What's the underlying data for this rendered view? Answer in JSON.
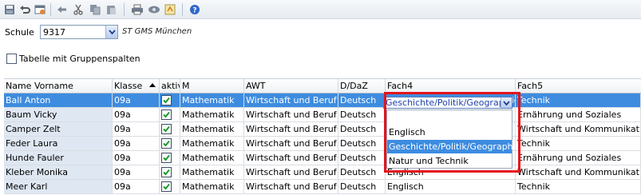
{
  "toolbar": {
    "icons": [
      "save-icon",
      "undo-icon",
      "reset-icon",
      "back-icon",
      "cut-icon",
      "copy-icon",
      "paste-icon",
      "print-icon",
      "preview-icon",
      "export-icon",
      "help-icon"
    ]
  },
  "school": {
    "label": "Schule",
    "value": "9317",
    "name": "ST GMS München"
  },
  "group_columns": {
    "label": "Tabelle mit Gruppenspalten",
    "checked": false
  },
  "grid": {
    "columns": [
      "Name Vorname",
      "Klasse",
      "aktiv",
      "M",
      "AWT",
      "D/DaZ",
      "Fach4",
      "Fach5"
    ],
    "rows": [
      {
        "name": "Ball Anton",
        "klasse": "09a",
        "aktiv": true,
        "m": "Mathematik",
        "awt": "Wirtschaft und Beruf",
        "d": "Deutsch",
        "fach4": "Geschichte/Politik/Geographie",
        "fach5": "Technik",
        "selected": true
      },
      {
        "name": "Baum Vicky",
        "klasse": "09a",
        "aktiv": true,
        "m": "Mathematik",
        "awt": "Wirtschaft und Beruf",
        "d": "Deutsch",
        "fach4": "",
        "fach5": "Ernährung und Soziales"
      },
      {
        "name": "Camper Zelt",
        "klasse": "09a",
        "aktiv": true,
        "m": "Mathematik",
        "awt": "Wirtschaft und Beruf",
        "d": "Deutsch",
        "fach4": "",
        "fach5": "Wirtschaft und Kommunikation"
      },
      {
        "name": "Feder Laura",
        "klasse": "09a",
        "aktiv": true,
        "m": "Mathematik",
        "awt": "Wirtschaft und Beruf",
        "d": "Deutsch",
        "fach4": "",
        "fach5": "Technik"
      },
      {
        "name": "Hunde Fauler",
        "klasse": "09a",
        "aktiv": true,
        "m": "Mathematik",
        "awt": "Wirtschaft und Beruf",
        "d": "Deutsch",
        "fach4": "",
        "fach5": "Ernährung und Soziales"
      },
      {
        "name": "Kleber Monika",
        "klasse": "09a",
        "aktiv": true,
        "m": "Mathematik",
        "awt": "Wirtschaft und Beruf",
        "d": "Deutsch",
        "fach4": "Englisch",
        "fach5": "Wirtschaft und Kommunikation"
      },
      {
        "name": "Meer Karl",
        "klasse": "09a",
        "aktiv": true,
        "m": "Mathematik",
        "awt": "Wirtschaft und Beruf",
        "d": "Deutsch",
        "fach4": "Englisch",
        "fach5": "Technik"
      }
    ]
  },
  "fach4_editor": {
    "value": "Geschichte/Politik/Geographie",
    "options": [
      "",
      "Englisch",
      "Geschichte/Politik/Geographie",
      "Natur und Technik"
    ],
    "highlighted": "Geschichte/Politik/Geographie"
  },
  "colors": {
    "selection": "#3d8ce0",
    "highlight_box": "#e5141b"
  }
}
